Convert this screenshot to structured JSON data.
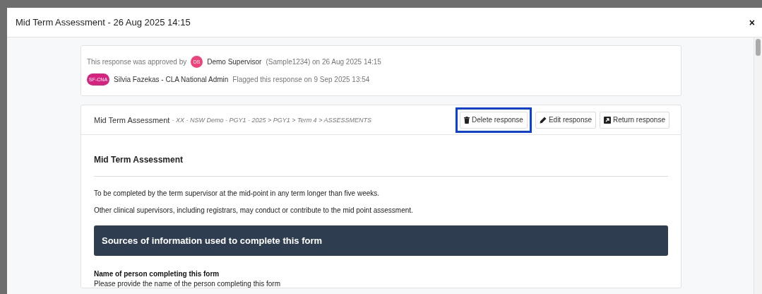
{
  "dialog": {
    "title": "Mid Term Assessment - 26 Aug 2025 14:15",
    "close": "×"
  },
  "approval": {
    "lines": [
      {
        "prefix": "This response was approved by",
        "avatar": "DS",
        "color": "#f0417a",
        "name": "Demo Supervisor",
        "rest": "(Sample1234) on 26 Aug 2025 14:15"
      },
      {
        "avatar": "SF-CNA",
        "color": "#d6237f",
        "name": "Silvia Fazekas - CLA National Admin",
        "rest": "Flagged this response on 9 Sep 2025 13:54"
      }
    ]
  },
  "response": {
    "title": "Mid Term Assessment",
    "path": "- XX - NSW Demo - PGY1 - 2025 > PGY1 > Term 4 > ASSESSMENTS",
    "buttons": [
      {
        "kind": "delete",
        "label": "Delete response",
        "highlighted": true
      },
      {
        "kind": "edit",
        "label": "Edit response",
        "highlighted": false
      },
      {
        "kind": "return",
        "label": "Return response",
        "highlighted": false
      }
    ],
    "heading": "Mid Term Assessment",
    "paragraphs": [
      "To be completed by the term supervisor at the mid-point in any term longer than five weeks.",
      "Other clinical supervisors, including registrars, may conduct or contribute to the mid point assessment."
    ],
    "section": "Sources of information used to complete this form",
    "question": {
      "label": "Name of person completing this form",
      "hint": "Please provide the name of the person completing this form"
    }
  }
}
